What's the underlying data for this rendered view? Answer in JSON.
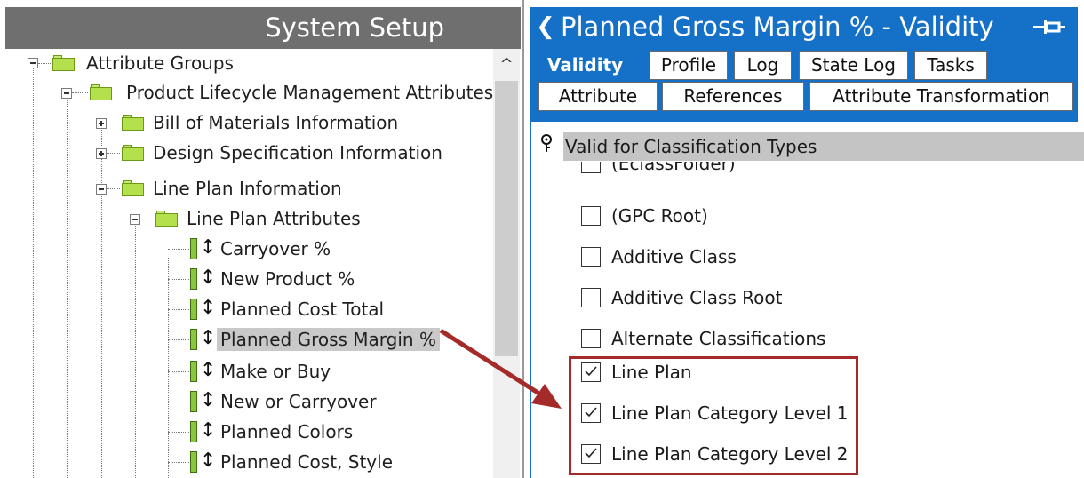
{
  "left": {
    "title": "System Setup",
    "tree": {
      "root": "Attribute Groups",
      "plm": "Product Lifecycle Management Attributes",
      "bom": "Bill of Materials Information",
      "design": "Design Specification Information",
      "line_plan_info": "Line Plan Information",
      "line_plan_attrs": "Line Plan Attributes",
      "attributes": [
        "Carryover %",
        "New Product %",
        "Planned Cost Total",
        "Planned Gross Margin %",
        "Make or Buy",
        "New or Carryover",
        "Planned Colors",
        "Planned Cost, Style"
      ]
    },
    "scroll_up_glyph": "^"
  },
  "right": {
    "back_glyph": "❮",
    "title": "Planned Gross Margin % - Validity",
    "tabs_row1": [
      "Validity",
      "Profile",
      "Log",
      "State Log",
      "Tasks"
    ],
    "tabs_row2": [
      "Attribute",
      "References",
      "Attribute Transformation"
    ],
    "section_header": "Valid for Classification Types",
    "checkbox_items": [
      {
        "label": "(EclassFolder)",
        "checked": false
      },
      {
        "label": "(GPC Root)",
        "checked": false
      },
      {
        "label": "Additive Class",
        "checked": false
      },
      {
        "label": "Additive Class Root",
        "checked": false
      },
      {
        "label": "Alternate Classifications",
        "checked": false
      },
      {
        "label": "Line Plan",
        "checked": true
      },
      {
        "label": "Line Plan Category Level 1",
        "checked": true
      },
      {
        "label": "Line Plan Category Level 2",
        "checked": true
      }
    ]
  },
  "colors": {
    "title_blue": "#1570c8",
    "left_title_gray": "#6f6f6f",
    "highlight_red": "#a52a2a",
    "folder_green": "#b4e04e"
  }
}
